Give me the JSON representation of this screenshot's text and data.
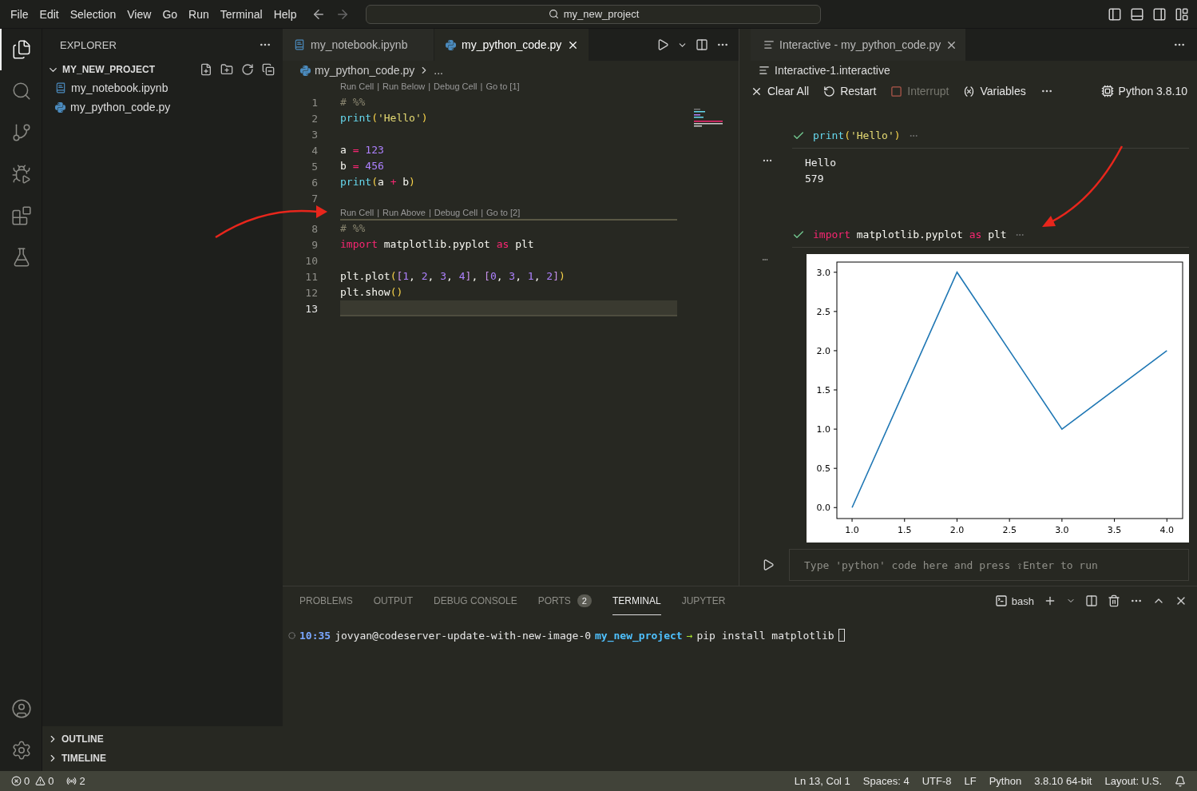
{
  "menu_bar": {
    "items": [
      "File",
      "Edit",
      "Selection",
      "View",
      "Go",
      "Run",
      "Terminal",
      "Help"
    ],
    "search": "my_new_project"
  },
  "activity_bar": {
    "items": [
      {
        "kind": "explorer",
        "selected": true
      },
      {
        "kind": "search",
        "selected": false
      },
      {
        "kind": "source-control",
        "selected": false
      },
      {
        "kind": "run-debug",
        "selected": false
      },
      {
        "kind": "extensions",
        "selected": false
      },
      {
        "kind": "testing",
        "selected": false
      }
    ],
    "bottom": [
      {
        "kind": "account"
      },
      {
        "kind": "settings"
      }
    ]
  },
  "sidebar": {
    "title": "EXPLORER",
    "project": {
      "name": "MY_NEW_PROJECT",
      "expanded": true,
      "children": [
        {
          "name": "my_notebook.ipynb",
          "kind": "notebook"
        },
        {
          "name": "my_python_code.py",
          "kind": "python"
        }
      ]
    },
    "sections": [
      {
        "name": "OUTLINE",
        "expanded": false
      },
      {
        "name": "TIMELINE",
        "expanded": false
      }
    ]
  },
  "editor": {
    "tabs": [
      {
        "label": "my_notebook.ipynb",
        "kind": "notebook",
        "selected": false
      },
      {
        "label": "my_python_code.py",
        "kind": "python",
        "selected": true
      }
    ],
    "breadcrumb": {
      "file": "my_python_code.py",
      "rest": "..."
    },
    "cells": [
      {
        "active": false,
        "codelens": {
          "separator": "|",
          "links": [
            "Run Cell",
            "Run Below",
            "Debug Cell",
            "Go to [1]"
          ]
        },
        "lines": [
          {
            "number": "1",
            "current": false,
            "tokens": [
              {
                "text": "# %%",
                "kind": "comment"
              }
            ]
          },
          {
            "number": "2",
            "current": false,
            "tokens": [
              {
                "text": "print",
                "kind": "fn"
              },
              {
                "text": "(",
                "kind": "paren"
              },
              {
                "text": "'Hello'",
                "kind": "str"
              },
              {
                "text": ")",
                "kind": "paren"
              }
            ]
          },
          {
            "number": "3",
            "current": false
          },
          {
            "number": "4",
            "current": false,
            "tokens": [
              {
                "text": "a ",
                "kind": "var"
              },
              {
                "text": "=",
                "kind": "op"
              },
              {
                "text": " 123",
                "kind": "num"
              }
            ]
          },
          {
            "number": "5",
            "current": false,
            "tokens": [
              {
                "text": "b ",
                "kind": "var"
              },
              {
                "text": "=",
                "kind": "op"
              },
              {
                "text": " 456",
                "kind": "num"
              }
            ]
          },
          {
            "number": "6",
            "current": false,
            "tokens": [
              {
                "text": "print",
                "kind": "fn"
              },
              {
                "text": "(",
                "kind": "paren"
              },
              {
                "text": "a ",
                "kind": "var"
              },
              {
                "text": "+",
                "kind": "op"
              },
              {
                "text": " b",
                "kind": "var"
              },
              {
                "text": ")",
                "kind": "paren"
              }
            ]
          },
          {
            "number": "7",
            "current": false
          }
        ]
      },
      {
        "active": true,
        "codelens": {
          "separator": "|",
          "links": [
            "Run Cell",
            "Run Above",
            "Debug Cell",
            "Go to [2]"
          ]
        },
        "lines": [
          {
            "number": "8",
            "current": false,
            "tokens": [
              {
                "text": "# %%",
                "kind": "comment"
              }
            ]
          },
          {
            "number": "9",
            "current": false,
            "tokens": [
              {
                "text": "import",
                "kind": "kw"
              },
              {
                "text": " matplotlib.pyplot ",
                "kind": "var"
              },
              {
                "text": "as",
                "kind": "kw"
              },
              {
                "text": " plt",
                "kind": "var"
              }
            ]
          },
          {
            "number": "10",
            "current": false
          },
          {
            "number": "11",
            "current": false,
            "tokens": [
              {
                "text": "plt.plot",
                "kind": "var"
              },
              {
                "text": "(",
                "kind": "paren"
              },
              {
                "text": "[",
                "kind": "bracket"
              },
              {
                "text": "1",
                "kind": "num"
              },
              {
                "text": ", ",
                "kind": "var"
              },
              {
                "text": "2",
                "kind": "num"
              },
              {
                "text": ", ",
                "kind": "var"
              },
              {
                "text": "3",
                "kind": "num"
              },
              {
                "text": ", ",
                "kind": "var"
              },
              {
                "text": "4",
                "kind": "num"
              },
              {
                "text": "]",
                "kind": "bracket"
              },
              {
                "text": ", ",
                "kind": "var"
              },
              {
                "text": "[",
                "kind": "bracket"
              },
              {
                "text": "0",
                "kind": "num"
              },
              {
                "text": ", ",
                "kind": "var"
              },
              {
                "text": "3",
                "kind": "num"
              },
              {
                "text": ", ",
                "kind": "var"
              },
              {
                "text": "1",
                "kind": "num"
              },
              {
                "text": ", ",
                "kind": "var"
              },
              {
                "text": "2",
                "kind": "num"
              },
              {
                "text": "]",
                "kind": "bracket"
              },
              {
                "text": ")",
                "kind": "paren"
              }
            ]
          },
          {
            "number": "12",
            "current": false,
            "tokens": [
              {
                "text": "plt.show",
                "kind": "var"
              },
              {
                "text": "()",
                "kind": "paren"
              }
            ]
          },
          {
            "number": "13",
            "current": true
          }
        ]
      }
    ]
  },
  "interactive": {
    "tab": "Interactive - my_python_code.py",
    "file": "Interactive-1.interactive",
    "toolbar": [
      {
        "label": "Clear All",
        "kind": "clear",
        "disabled": false
      },
      {
        "label": "Restart",
        "kind": "restart",
        "disabled": false
      },
      {
        "label": "Interrupt",
        "kind": "interrupt",
        "disabled": true
      },
      {
        "label": "Variables",
        "kind": "variables",
        "disabled": false
      }
    ],
    "kernel": "Python 3.8.10",
    "cells": [
      {
        "succeeded": true,
        "tokens": [
          {
            "text": "print",
            "kind": "fn"
          },
          {
            "text": "(",
            "kind": "paren"
          },
          {
            "text": "'Hello'",
            "kind": "str"
          },
          {
            "text": ")",
            "kind": "paren"
          }
        ],
        "output": {
          "kind": "text",
          "lines": [
            "Hello",
            "579"
          ]
        }
      },
      {
        "succeeded": true,
        "tokens": [
          {
            "text": "import",
            "kind": "kw"
          },
          {
            "text": " matplotlib.pyplot ",
            "kind": "var"
          },
          {
            "text": "as",
            "kind": "kw"
          },
          {
            "text": " plt",
            "kind": "var"
          }
        ],
        "output": {
          "kind": "chart",
          "chart_data": {
            "type": "line",
            "x": [
              1,
              2,
              3,
              4
            ],
            "series": [
              {
                "color": "#1f77b4",
                "values": [
                  0,
                  3,
                  1,
                  2
                ]
              }
            ],
            "xlim": [
              0.855,
              4.15
            ],
            "ylim": [
              -0.14,
              3.13
            ],
            "xticks": [
              {
                "value": 1,
                "label": "1.0"
              },
              {
                "value": 1.5,
                "label": "1.5"
              },
              {
                "value": 2,
                "label": "2.0"
              },
              {
                "value": 2.5,
                "label": "2.5"
              },
              {
                "value": 3,
                "label": "3.0"
              },
              {
                "value": 3.5,
                "label": "3.5"
              },
              {
                "value": 4,
                "label": "4.0"
              }
            ],
            "yticks": [
              {
                "value": 0,
                "label": "0.0"
              },
              {
                "value": 0.5,
                "label": "0.5"
              },
              {
                "value": 1,
                "label": "1.0"
              },
              {
                "value": 1.5,
                "label": "1.5"
              },
              {
                "value": 2,
                "label": "2.0"
              },
              {
                "value": 2.5,
                "label": "2.5"
              },
              {
                "value": 3,
                "label": "3.0"
              }
            ]
          }
        }
      }
    ],
    "input_placeholder": "Type 'python' code here and press ⇧Enter to run"
  },
  "panel": {
    "tabs": [
      {
        "label": "PROBLEMS",
        "selected": false
      },
      {
        "label": "OUTPUT",
        "selected": false
      },
      {
        "label": "DEBUG CONSOLE",
        "selected": false
      },
      {
        "label": "PORTS",
        "badge": "2",
        "selected": false
      },
      {
        "label": "TERMINAL",
        "selected": true
      },
      {
        "label": "JUPYTER",
        "selected": false
      }
    ],
    "shell": "bash",
    "terminal": {
      "time": "10:35",
      "user": "jovyan@codeserver-update-with-new-image-0",
      "dir": "my_new_project",
      "arrow": "→",
      "command": "pip install matplotlib"
    }
  },
  "status_bar": {
    "errors": "0",
    "warnings": "0",
    "ports": "2",
    "right": [
      "Ln 13, Col 1",
      "Spaces: 4",
      "UTF-8",
      "LF",
      "Python",
      "3.8.10 64-bit",
      "Layout: U.S."
    ]
  }
}
